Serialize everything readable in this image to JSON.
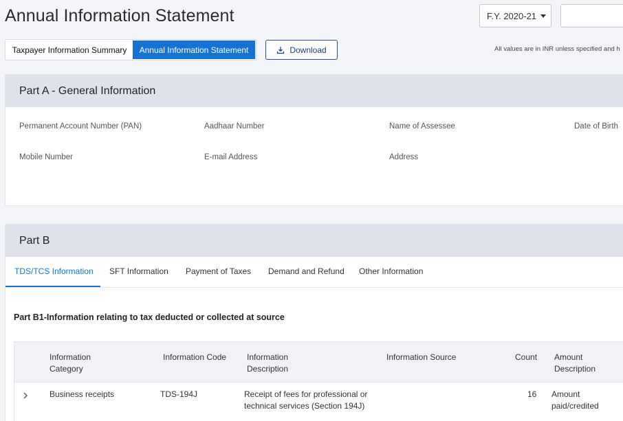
{
  "header": {
    "title": "Annual Information Statement",
    "fy_select": "F.Y. 2020-21",
    "inr_note": "All values are in INR unless specified and h"
  },
  "toggle": {
    "summary_label": "Taxpayer Information Summary",
    "ais_label": "Annual Information Statement"
  },
  "download_label": "Download",
  "part_a": {
    "title": "Part A - General Information",
    "fields": {
      "pan": "Permanent Account Number (PAN)",
      "aadhaar": "Aadhaar Number",
      "name": "Name of Assessee",
      "dob": "Date of Birth",
      "mobile": "Mobile Number",
      "email": "E-mail Address",
      "address": "Address"
    }
  },
  "part_b": {
    "title": "Part B",
    "tabs": [
      "TDS/TCS Information",
      "SFT Information",
      "Payment of Taxes",
      "Demand and Refund",
      "Other Information"
    ],
    "section_title": "Part B1-Information relating to tax deducted or collected at source",
    "table": {
      "headers": {
        "category_l1": "Information",
        "category_l2": "Category",
        "code": "Information Code",
        "desc_l1": "Information",
        "desc_l2": "Description",
        "source": "Information Source",
        "count": "Count",
        "amount_l1": "Amount",
        "amount_l2": "Description"
      },
      "rows": [
        {
          "category": "Business receipts",
          "code": "TDS-194J",
          "desc_l1": "Receipt of fees for professional or",
          "desc_l2": "technical services (Section 194J)",
          "count": "16",
          "amount_l1": "Amount",
          "amount_l2": "paid/credited"
        }
      ]
    }
  },
  "colors": {
    "accent": "#1473d4",
    "header_band": "#dfe2eb",
    "page_bg": "#f4f5f9"
  }
}
